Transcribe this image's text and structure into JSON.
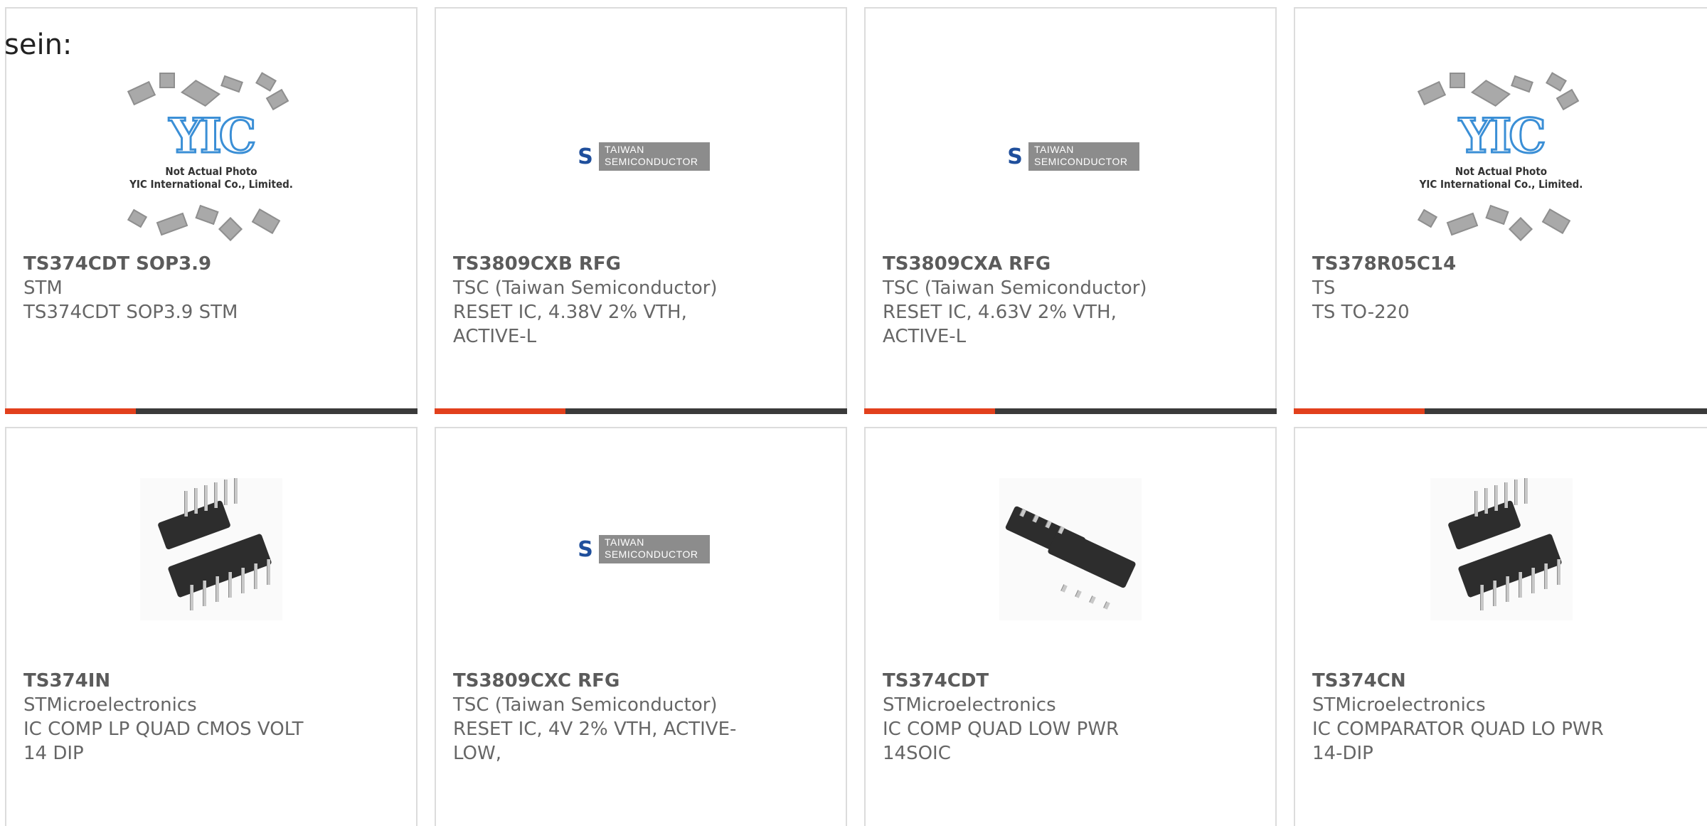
{
  "prefix_text": "sein:",
  "accent_color": "#e2401c",
  "bar_color": "#3a3a3a",
  "yic_image": {
    "logo": "YIC",
    "note_line1": "Not Actual Photo",
    "note_line2": "YIC International Co., Limited."
  },
  "tsc_logo": {
    "line1": "TAIWAN",
    "line2": "SEMICONDUCTOR"
  },
  "products": [
    {
      "part": "TS374CDT SOP3.9",
      "manufacturer": "STM",
      "desc1": "TS374CDT SOP3.9 STM",
      "desc2": "",
      "image": "yic-placeholder"
    },
    {
      "part": "TS3809CXB RFG",
      "manufacturer": "TSC (Taiwan Semiconductor)",
      "desc1": "RESET IC, 4.38V 2% VTH,",
      "desc2": "ACTIVE-L",
      "image": "tsc-logo"
    },
    {
      "part": "TS3809CXA RFG",
      "manufacturer": "TSC (Taiwan Semiconductor)",
      "desc1": "RESET IC, 4.63V 2% VTH,",
      "desc2": "ACTIVE-L",
      "image": "tsc-logo"
    },
    {
      "part": "TS378R05C14",
      "manufacturer": "TS",
      "desc1": "TS TO-220",
      "desc2": "",
      "image": "yic-placeholder"
    },
    {
      "part": "TS374IN",
      "manufacturer": "STMicroelectronics",
      "desc1": "IC COMP LP QUAD CMOS VOLT",
      "desc2": "14 DIP",
      "image": "dip-chip"
    },
    {
      "part": "TS3809CXC RFG",
      "manufacturer": "TSC (Taiwan Semiconductor)",
      "desc1": "RESET IC, 4V 2% VTH, ACTIVE-",
      "desc2": "LOW,",
      "image": "tsc-logo"
    },
    {
      "part": "TS374CDT",
      "manufacturer": "STMicroelectronics",
      "desc1": "IC COMP QUAD LOW PWR",
      "desc2": "14SOIC",
      "image": "soic-chip"
    },
    {
      "part": "TS374CN",
      "manufacturer": "STMicroelectronics",
      "desc1": "IC COMPARATOR QUAD LO PWR",
      "desc2": "14-DIP",
      "image": "dip-chip"
    }
  ]
}
